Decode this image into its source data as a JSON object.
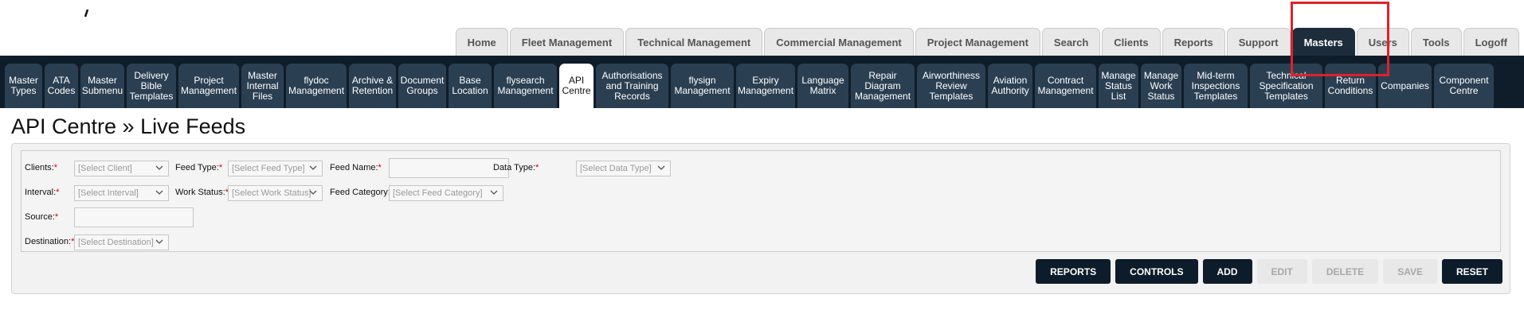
{
  "main_nav": {
    "tabs": [
      {
        "label": "Home"
      },
      {
        "label": "Fleet Management"
      },
      {
        "label": "Technical Management"
      },
      {
        "label": "Commercial Management"
      },
      {
        "label": "Project Management"
      },
      {
        "label": "Search"
      },
      {
        "label": "Clients"
      },
      {
        "label": "Reports"
      },
      {
        "label": "Support"
      },
      {
        "label": "Masters",
        "active": true
      },
      {
        "label": "Users"
      },
      {
        "label": "Tools"
      },
      {
        "label": "Logoff"
      }
    ]
  },
  "sub_nav": {
    "tabs": [
      {
        "label": "Master\nTypes"
      },
      {
        "label": "ATA\nCodes"
      },
      {
        "label": "Master\nSubmenu"
      },
      {
        "label": "Delivery\nBible\nTemplates"
      },
      {
        "label": "Project\nManagement"
      },
      {
        "label": "Master\nInternal\nFiles"
      },
      {
        "label": "flydoc\nManagement"
      },
      {
        "label": "Archive &\nRetention"
      },
      {
        "label": "Document\nGroups"
      },
      {
        "label": "Base\nLocation"
      },
      {
        "label": "flysearch\nManagement"
      },
      {
        "label": "API\nCentre",
        "active": true
      },
      {
        "label": "Authorisations\nand Training\nRecords"
      },
      {
        "label": "flysign\nManagement"
      },
      {
        "label": "Expiry\nManagement"
      },
      {
        "label": "Language\nMatrix"
      },
      {
        "label": "Repair\nDiagram\nManagement"
      },
      {
        "label": "Airworthiness\nReview\nTemplates"
      },
      {
        "label": "Aviation\nAuthority"
      },
      {
        "label": "Contract\nManagement"
      },
      {
        "label": "Manage\nStatus\nList"
      },
      {
        "label": "Manage\nWork\nStatus"
      },
      {
        "label": "Mid-term\nInspections\nTemplates"
      },
      {
        "label": "Technical\nSpecification\nTemplates"
      },
      {
        "label": "Return\nConditions"
      },
      {
        "label": "Companies"
      },
      {
        "label": "Component\nCentre"
      }
    ]
  },
  "page": {
    "title": "API Centre » Live Feeds"
  },
  "form": {
    "required_mark": "*",
    "clients": {
      "label": "Clients:",
      "placeholder": "[Select Client]"
    },
    "feed_type": {
      "label": "Feed Type:",
      "placeholder": "[Select Feed Type]"
    },
    "feed_name": {
      "label": "Feed Name:",
      "value": ""
    },
    "data_type": {
      "label": "Data Type:",
      "placeholder": "[Select Data Type]"
    },
    "interval": {
      "label": "Interval:",
      "placeholder": "[Select Interval]"
    },
    "work_status": {
      "label": "Work Status:",
      "placeholder": "[Select Work Status]"
    },
    "feed_category": {
      "label": "Feed Category:",
      "placeholder": "[Select Feed Category]"
    },
    "source": {
      "label": "Source:",
      "value": ""
    },
    "destination": {
      "label": "Destination:",
      "placeholder": "[Select Destination]"
    }
  },
  "actions": {
    "buttons": [
      {
        "label": "REPORTS",
        "enabled": true
      },
      {
        "label": "CONTROLS",
        "enabled": true
      },
      {
        "label": "ADD",
        "enabled": true
      },
      {
        "label": "EDIT",
        "enabled": false
      },
      {
        "label": "DELETE",
        "enabled": false
      },
      {
        "label": "SAVE",
        "enabled": false
      },
      {
        "label": "RESET",
        "enabled": true
      }
    ]
  },
  "colors": {
    "nav_dark": "#0f1d2a",
    "tab_dark": "#2b3f52",
    "highlight": "#e0202a",
    "required": "#d40000"
  }
}
